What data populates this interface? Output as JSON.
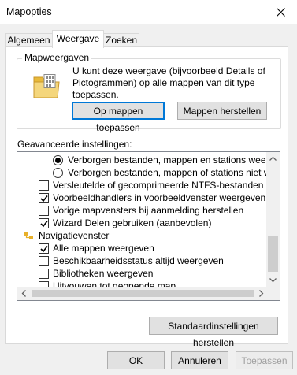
{
  "window": {
    "title": "Mapopties"
  },
  "tabs": [
    {
      "label": "Algemeen",
      "active": false
    },
    {
      "label": "Weergave",
      "active": true
    },
    {
      "label": "Zoeken",
      "active": false
    }
  ],
  "folder_views": {
    "label": "Mapweergaven",
    "description": "U kunt deze weergave (bijvoorbeeld Details of Pictogrammen) op alle mappen van dit type toepassen.",
    "apply_button": "Op mappen toepassen",
    "reset_button": "Mappen herstellen"
  },
  "advanced": {
    "label": "Geavanceerde instellingen:",
    "items": [
      {
        "type": "radio",
        "checked": true,
        "label": "Verborgen bestanden, mappen en stations weergeven"
      },
      {
        "type": "radio",
        "checked": false,
        "label": "Verborgen bestanden, mappen of stations niet weergeven"
      },
      {
        "type": "checkbox",
        "checked": false,
        "label": "Versleutelde of gecomprimeerde NTFS-bestanden in een andere kleur weergeven"
      },
      {
        "type": "checkbox",
        "checked": true,
        "label": "Voorbeeldhandlers in voorbeeldvenster weergeven"
      },
      {
        "type": "checkbox",
        "checked": false,
        "label": "Vorige mapvensters bij aanmelding herstellen"
      },
      {
        "type": "checkbox",
        "checked": true,
        "label": "Wizard Delen gebruiken (aanbevolen)"
      },
      {
        "type": "group",
        "icon": "navigation-pane-icon",
        "label": "Navigatievenster"
      },
      {
        "type": "checkbox",
        "checked": true,
        "label": "Alle mappen weergeven"
      },
      {
        "type": "checkbox",
        "checked": false,
        "label": "Beschikbaarheidsstatus altijd weergeven"
      },
      {
        "type": "checkbox",
        "checked": false,
        "label": "Bibliotheken weergeven"
      },
      {
        "type": "checkbox",
        "checked": false,
        "label": "Uitvouwen tot geopende map"
      }
    ],
    "restore_defaults_button": "Standaardinstellingen herstellen"
  },
  "footer": {
    "ok": "OK",
    "cancel": "Annuleren",
    "apply": "Toepassen"
  },
  "colors": {
    "accent": "#0078d7",
    "window_bg": "#f0f0f0",
    "disabled_text": "#a0a0a0",
    "navigation_icon": "#e8b02a"
  }
}
